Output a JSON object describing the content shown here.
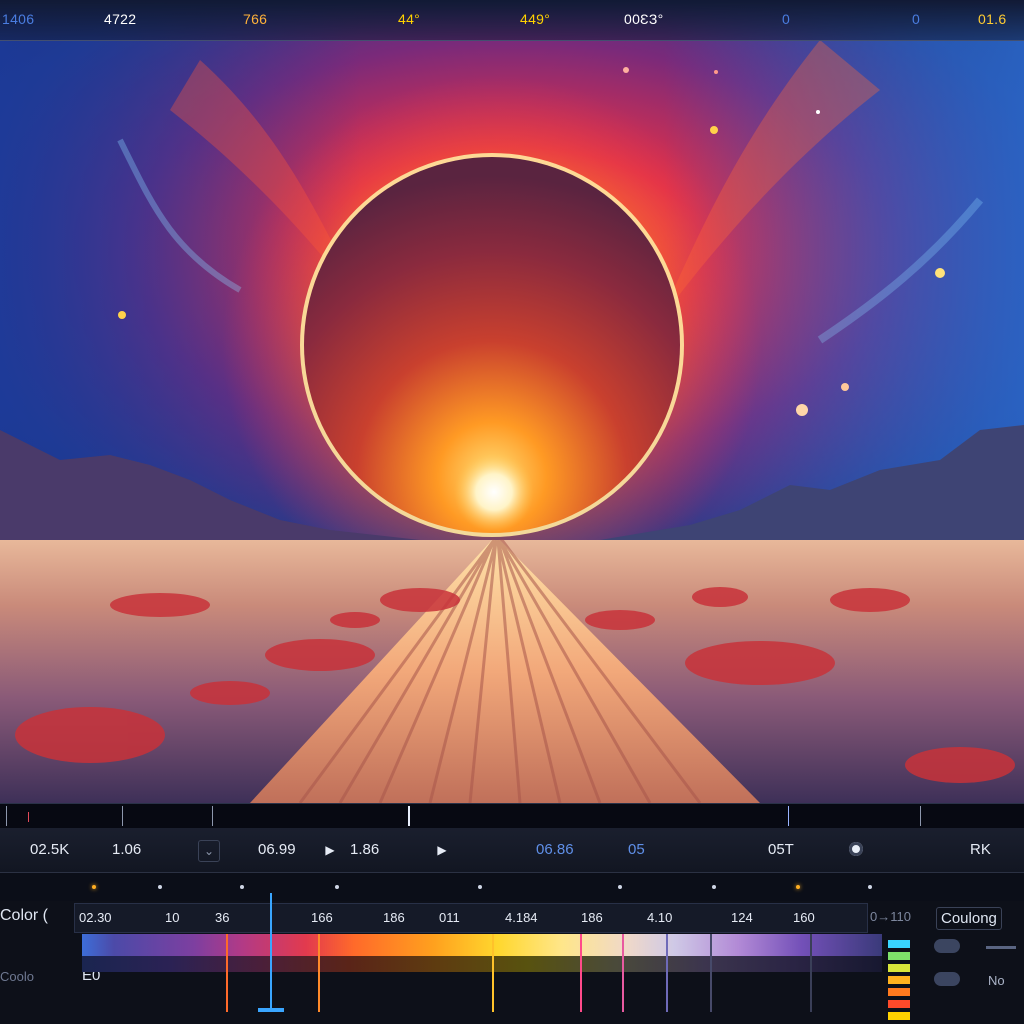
{
  "top_readouts": [
    {
      "text": "1406",
      "color": "#4a7de0"
    },
    {
      "text": "4722",
      "color": "#ffffff"
    },
    {
      "text": "766",
      "color": "#ffb23a"
    },
    {
      "text": "44°",
      "color": "#ffd200"
    },
    {
      "text": "449°",
      "color": "#ffd200"
    },
    {
      "text": "00ƐЗ°",
      "color": "#ffffff"
    },
    {
      "text": "0",
      "color": "#4a7de0"
    },
    {
      "text": "0",
      "color": "#4a7de0"
    },
    {
      "text": "01.6",
      "color": "#ffcc33"
    }
  ],
  "transport": {
    "timecode_left": "02.5K",
    "value_a": "1.06",
    "value_b": "06.99",
    "value_c": "1.86",
    "value_blue_a": "06.86",
    "value_blue_b": "05",
    "value_right": "05T",
    "value_far_right": "RK"
  },
  "ruler": {
    "orange_dots": 2,
    "white_dots": 7
  },
  "color_panel": {
    "label": "Color (",
    "sub_label": "Coolo",
    "track_label": "E0",
    "right_label": "Coulong",
    "right_sub": "No",
    "numbers": [
      "02.30",
      "10",
      "36",
      "166",
      "186",
      "011",
      "4.184",
      "186",
      "4.10",
      "124",
      "160",
      "0→110"
    ],
    "swatch_colors": [
      "#39d5ff",
      "#7ee06a",
      "#d8e63a",
      "#ffb21e",
      "#ff7a1e",
      "#ff4a2a",
      "#ffd200"
    ]
  }
}
